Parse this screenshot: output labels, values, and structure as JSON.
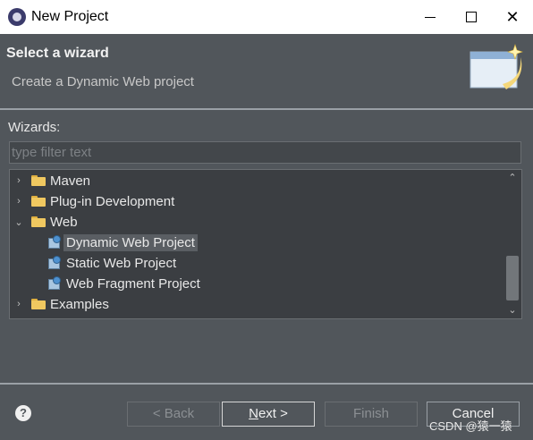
{
  "window": {
    "title": "New Project",
    "minimize_icon": "minimize-icon",
    "maximize_icon": "maximize-icon",
    "close_glyph": "✕"
  },
  "header": {
    "title": "Select a wizard",
    "description": "Create a Dynamic Web project"
  },
  "wizards": {
    "label": "Wizards:",
    "filter_placeholder": "type filter text"
  },
  "tree": {
    "items": [
      {
        "label": "Maven",
        "twisty": "›",
        "icon": "folder-icon"
      },
      {
        "label": "Plug-in Development",
        "twisty": "›",
        "icon": "folder-icon"
      },
      {
        "label": "Web",
        "twisty": "⌄",
        "icon": "folder-icon"
      },
      {
        "label": "Dynamic Web Project",
        "icon": "web-project-icon",
        "selected": true
      },
      {
        "label": "Static Web Project",
        "icon": "web-project-icon"
      },
      {
        "label": "Web Fragment Project",
        "icon": "web-project-icon"
      },
      {
        "label": "Examples",
        "twisty": "›",
        "icon": "folder-icon"
      }
    ]
  },
  "scrollbar": {
    "up": "⌃",
    "down": "⌄"
  },
  "footer": {
    "help_glyph": "?",
    "back_label": "< Back",
    "next_label_accel": "N",
    "next_label_rest": "ext >",
    "finish_label": "Finish",
    "cancel_label": "Cancel"
  },
  "watermark": "CSDN @猿一猿"
}
